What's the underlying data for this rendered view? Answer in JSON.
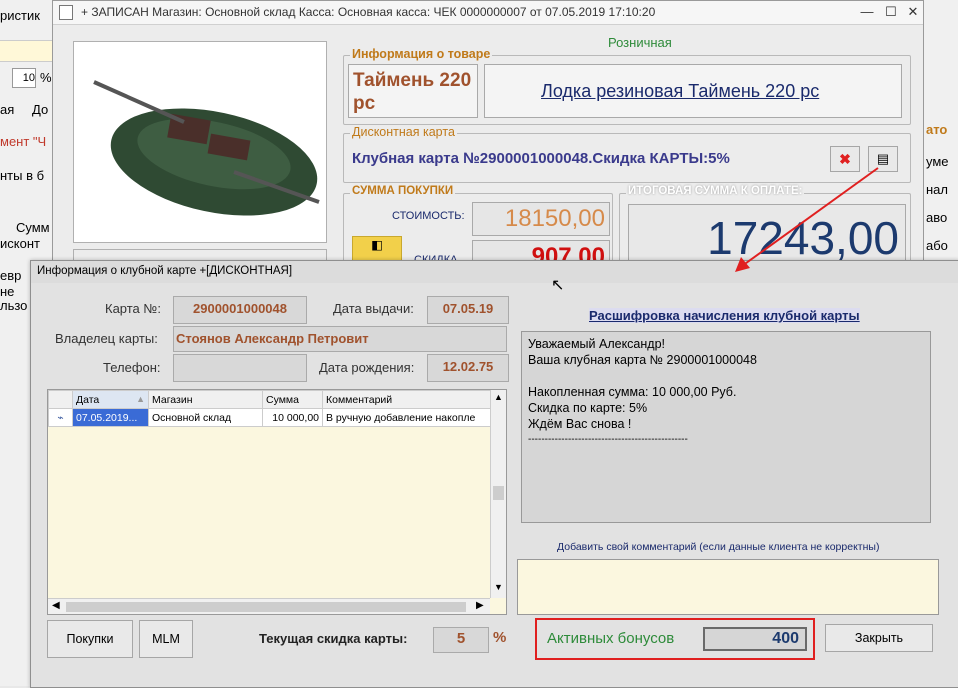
{
  "background": {
    "left_texts": [
      "ристик",
      "10",
      "%",
      "ая",
      "До",
      "мент \"Ч",
      "нты в б",
      "Сумм",
      "исконт",
      "евр",
      "не",
      "льзо"
    ],
    "right_texts": [
      "ато",
      "уме",
      "нал",
      "аво",
      "або"
    ]
  },
  "main_window": {
    "title": "+ ЗАПИСАН Магазин: Основной склад Касса: Основная касса: ЧЕК 0000000007 от 07.05.2019 17:10:20",
    "minimize": "—",
    "maximize": "☐",
    "close": "✕",
    "price_type": "Розничная",
    "product_group_label": "Информация о товаре",
    "product_short": "Таймень 220 рс",
    "product_full": "Лодка резиновая Таймень 220 рс",
    "discount_group_label": "Дисконтная карта",
    "discount_card_text": "Клубная карта №2900001000048.Скидка КАРТЫ:5%",
    "sum_group_label": "СУММА ПОКУПКИ",
    "cost_label": "СТОИМОСТЬ:",
    "cost_value": "18150,00",
    "discount_label": "СКИДКА",
    "discount_value": "907,00",
    "total_group_label": "ИТОГОВАЯ СУММА К ОПЛАТЕ:",
    "total_value": "17243,00"
  },
  "dialog": {
    "title": "Информация о клубной карте +[ДИСКОНТНАЯ]",
    "card_label": "Карта №:",
    "card_value": "2900001000048",
    "issue_date_label": "Дата выдачи:",
    "issue_date_value": "07.05.19",
    "owner_label": "Владелец карты:",
    "owner_value": "Стоянов Александр Петровит",
    "phone_label": "Телефон:",
    "phone_value": "",
    "birth_label": "Дата рождения:",
    "birth_value": "12.02.75",
    "table": {
      "columns": [
        "Дата",
        "Магазин",
        "Сумма",
        "Комментарий"
      ],
      "rows": [
        {
          "date": "07.05.2019...",
          "store": "Основной склад",
          "sum": "10 000,00",
          "comment": "В ручную добавление накопле"
        }
      ]
    },
    "decode_link": "Расшифровка начисления клубной карты",
    "message_lines": [
      "Уважаемый Александр!",
      "Ваша клубная карта № 2900001000048",
      "",
      "Накопленная сумма: 10 000,00 Руб.",
      "Скидка по карте: 5%",
      "Ждём Вас снова !",
      "------------------------------------------------"
    ],
    "comment_hint": "Добавить свой комментарий (если данные клиента не корректны)",
    "comment_value": "",
    "purchases_button": "Покупки",
    "mlm_button": "MLM",
    "current_discount_label": "Текущая скидка карты:",
    "current_discount_value": "5",
    "percent_sign": "%",
    "active_bonus_label": "Активных бонусов",
    "active_bonus_value": "400",
    "close_button": "Закрыть"
  },
  "colors": {
    "accent_orange": "#c07a1a",
    "value_brown": "#a0522d",
    "link_blue": "#1a2a6c",
    "total_blue": "#1c3a6e",
    "discount_red": "#d01010",
    "highlight_red": "#e02020",
    "bonus_green": "#2e8b3a"
  }
}
